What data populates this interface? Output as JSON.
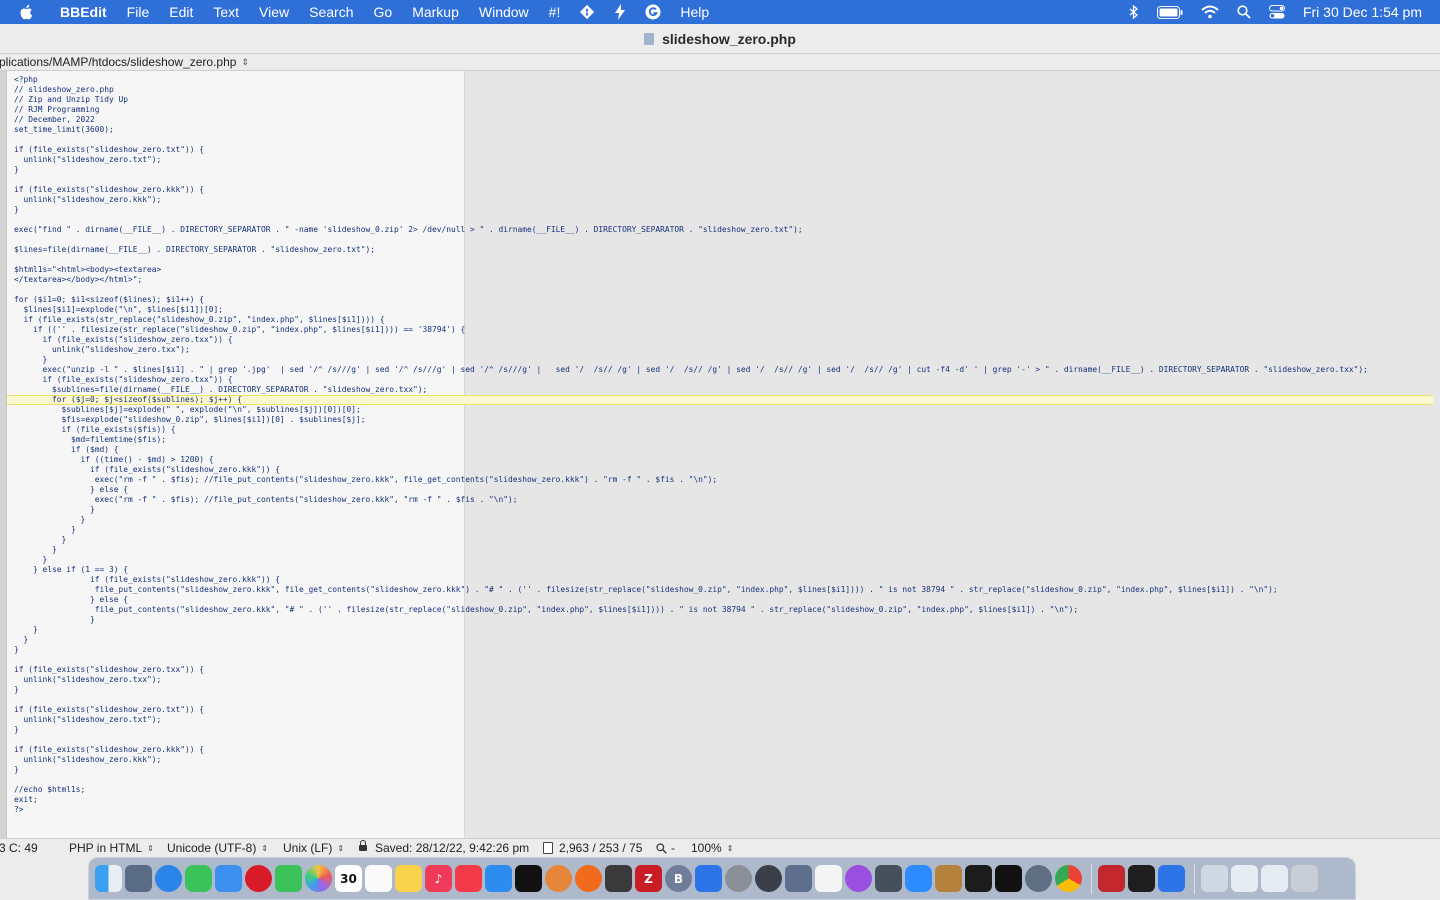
{
  "menubar": {
    "app_name": "BBEdit",
    "items": [
      "File",
      "Edit",
      "Text",
      "View",
      "Search",
      "Go",
      "Markup",
      "Window",
      "#!"
    ],
    "help": "Help",
    "clock": "Fri 30 Dec  1:54 pm",
    "colors": {
      "bar": "#2f6fd8"
    }
  },
  "window": {
    "title": "slideshow_zero.php",
    "path": "plications/MAMP/htdocs/slideshow_zero.php"
  },
  "code_lines": [
    "<?php",
    "// slideshow_zero.php",
    "// Zip and Unzip Tidy Up",
    "// RJM Programming",
    "// December, 2022",
    "set_time_limit(3600);",
    "",
    "if (file_exists(\"slideshow_zero.txt\")) {",
    "  unlink(\"slideshow_zero.txt\");",
    "}",
    "",
    "if (file_exists(\"slideshow_zero.kkk\")) {",
    "  unlink(\"slideshow_zero.kkk\");",
    "}",
    "",
    "exec(\"find \" . dirname(__FILE__) . DIRECTORY_SEPARATOR . \" -name 'slideshow_0.zip' 2> /dev/null > \" . dirname(__FILE__) . DIRECTORY_SEPARATOR . \"slideshow_zero.txt\");",
    "",
    "$lines=file(dirname(__FILE__) . DIRECTORY_SEPARATOR . \"slideshow_zero.txt\");",
    "",
    "$html1s=\"<html><body><textarea>",
    "</textarea></body></html>\";",
    "",
    "for ($i1=0; $i1<sizeof($lines); $i1++) {",
    "  $lines[$i1]=explode(\"\\n\", $lines[$i1])[0];",
    "  if (file_exists(str_replace(\"slideshow_0.zip\", \"index.php\", $lines[$i1]))) {",
    "    if (('' . filesize(str_replace(\"slideshow_0.zip\", \"index.php\", $lines[$i1]))) == '38794') {",
    "      if (file_exists(\"slideshow_zero.txx\")) {",
    "        unlink(\"slideshow_zero.txx\");",
    "      }",
    "      exec(\"unzip -l \" . $lines[$i1] . \" | grep '.jpg'  | sed '/^ /s///g' | sed '/^ /s///g' | sed '/^ /s///g' |   sed '/  /s// /g' | sed '/  /s// /g' | sed '/  /s// /g' | sed '/  /s// /g' | cut -f4 -d' ' | grep '-' > \" . dirname(__FILE__) . DIRECTORY_SEPARATOR . \"slideshow_zero.txx\");",
    "      if (file_exists(\"slideshow_zero.txx\")) {",
    "        $sublines=file(dirname(__FILE__) . DIRECTORY_SEPARATOR . \"slideshow_zero.txx\");",
    "        for ($j=0; $j<sizeof($sublines); $j++) {",
    "          $sublines[$j]=explode(\" \", explode(\"\\n\", $sublines[$j])[0])[0];",
    "          $fis=explode(\"slideshow_0.zip\", $lines[$i1])[0] . $sublines[$j];",
    "          if (file_exists($fis)) {",
    "            $md=filemtime($fis);",
    "            if ($md) {",
    "              if ((time() - $md) > 1200) {",
    "                if (file_exists(\"slideshow_zero.kkk\")) {",
    "                 exec(\"rm -f \" . $fis); //file_put_contents(\"slideshow_zero.kkk\", file_get_contents(\"slideshow_zero.kkk\") . \"rm -f \" . $fis . \"\\n\");",
    "                } else {",
    "                 exec(\"rm -f \" . $fis); //file_put_contents(\"slideshow_zero.kkk\", \"rm -f \" . $fis . \"\\n\");",
    "                }",
    "              }",
    "            }",
    "          }",
    "        }",
    "      }",
    "    } else if (1 == 3) {",
    "                if (file_exists(\"slideshow_zero.kkk\")) {",
    "                 file_put_contents(\"slideshow_zero.kkk\", file_get_contents(\"slideshow_zero.kkk\") . \"# \" . ('' . filesize(str_replace(\"slideshow_0.zip\", \"index.php\", $lines[$i1]))) . \" is not 38794 \" . str_replace(\"slideshow_0.zip\", \"index.php\", $lines[$i1]) . \"\\n\");",
    "                } else {",
    "                 file_put_contents(\"slideshow_zero.kkk\", \"# \" . ('' . filesize(str_replace(\"slideshow_0.zip\", \"index.php\", $lines[$i1]))) . \" is not 38794 \" . str_replace(\"slideshow_0.zip\", \"index.php\", $lines[$i1]) . \"\\n\");",
    "                }",
    "    }",
    "  }",
    "}",
    "",
    "if (file_exists(\"slideshow_zero.txx\")) {",
    "  unlink(\"slideshow_zero.txx\");",
    "}",
    "",
    "if (file_exists(\"slideshow_zero.txt\")) {",
    "  unlink(\"slideshow_zero.txt\");",
    "}",
    "",
    "if (file_exists(\"slideshow_zero.kkk\")) {",
    "  unlink(\"slideshow_zero.kkk\");",
    "}",
    "",
    "//echo $html1s;",
    "exit;",
    "?>"
  ],
  "current_line_index": 32,
  "statusbar": {
    "position": "3 C: 49",
    "language": "PHP in HTML",
    "encoding": "Unicode (UTF-8)",
    "line_endings": "Unix (LF)",
    "saved": "Saved: 28/12/22, 9:42:26 pm",
    "counts": "2,963 / 253 / 75",
    "zoom": "100%"
  },
  "dock": {
    "calendar_month": "DEC",
    "calendar_day": "30",
    "filezilla_letter": "Z",
    "bbedit_letter": "B"
  }
}
